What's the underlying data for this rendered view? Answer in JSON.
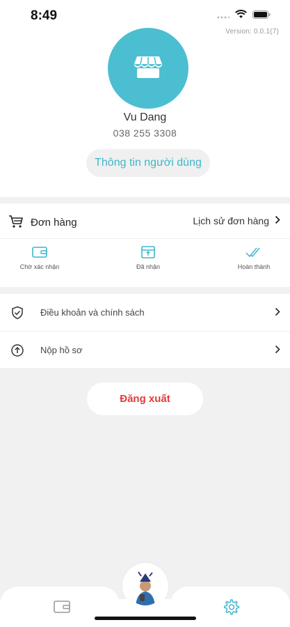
{
  "status_bar": {
    "time": "8:49"
  },
  "version": "Version:  0.0.1(7)",
  "profile": {
    "name": "Vu Dang",
    "phone": "038 255 3308",
    "info_button": "Thông tin người dùng",
    "avatar_icon": "store-icon",
    "avatar_color": "#4bbfd1"
  },
  "orders": {
    "label": "Đơn hàng",
    "history_link": "Lịch sử đơn hàng",
    "statuses": [
      {
        "label": "Chờ xác nhận",
        "icon": "wallet-icon"
      },
      {
        "label": "Đã nhận",
        "icon": "receive-box-icon"
      },
      {
        "label": "Hoàn thành",
        "icon": "double-check-icon"
      }
    ]
  },
  "menu": [
    {
      "label": "Điều khoản và chính sách",
      "icon": "shield-check-icon"
    },
    {
      "label": "Nộp hồ sơ",
      "icon": "upload-circle-icon"
    }
  ],
  "logout_button": "Đăng xuất",
  "colors": {
    "accent": "#3fb6cb",
    "danger": "#e23b3b",
    "background": "#f1f1f1"
  },
  "tabbar": {
    "left_icon": "wallet-icon",
    "right_icon": "gear-icon"
  }
}
